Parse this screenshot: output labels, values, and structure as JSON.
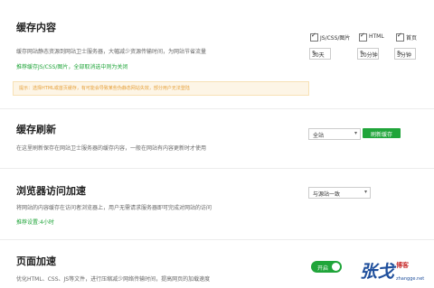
{
  "cache_content": {
    "title": "缓存内容",
    "desc": "缓存网站静态资源到网站卫士服务器，大幅减少资源传输时间，为网站节省流量",
    "recommend": "推荐缓存JS/CSS/图片，全部取消选中则为关闭",
    "notice": "提示：选择HTML或首页缓存，有可能会导致某些伪静态网站失效，部分用户无法登陆",
    "options": [
      {
        "label": "JS/CSS/图片",
        "checked": true,
        "duration": "30天"
      },
      {
        "label": "HTML",
        "checked": true,
        "duration": "10分钟"
      },
      {
        "label": "首页",
        "checked": true,
        "duration": "5分钟"
      }
    ]
  },
  "cache_refresh": {
    "title": "缓存刷新",
    "desc": "在这里刷新保存在网站卫士服务器的缓存内容，一般在网站有内容更新时才使用",
    "select_value": "全站",
    "button_label": "刷新缓存"
  },
  "browser_cache": {
    "title": "浏览器访问加速",
    "desc": "将网站的内容缓存在访问者浏览器上，用户无需请求服务器即可完成对网站的访问",
    "recommend": "推荐设置:4小时",
    "select_value": "与源站一致"
  },
  "page_accel": {
    "title": "页面加速",
    "desc": "优化HTML、CSS、JS等文件，进行压缩减少网络传输时间，提高网页的加载速度",
    "toggle_label": "开启",
    "toggle_on": true
  },
  "watermark": {
    "big": "张戈",
    "small": "博客",
    "url": "zhangge.net"
  },
  "colors": {
    "accent": "#20a53a",
    "notice_bg": "#fdf5e6",
    "notice_text": "#e6a23c"
  }
}
